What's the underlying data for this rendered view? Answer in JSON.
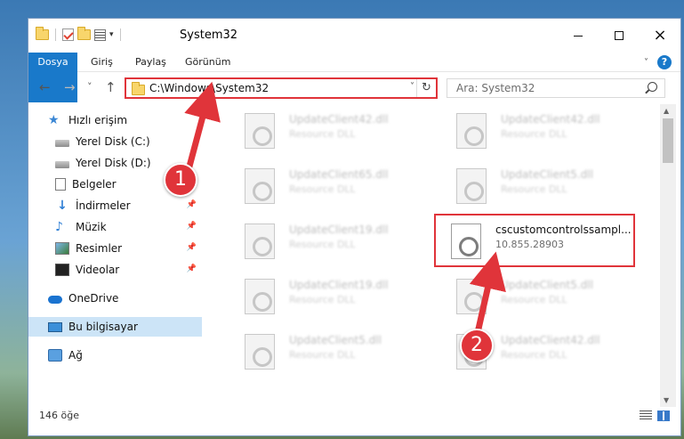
{
  "window": {
    "title": "System32",
    "controls": {
      "minimize": "minimize-icon",
      "maximize": "maximize-icon",
      "close": "×"
    }
  },
  "ribbon": {
    "tabs": [
      "Dosya",
      "Giriş",
      "Paylaş",
      "Görünüm"
    ],
    "help": "?"
  },
  "navigation": {
    "back": "←",
    "forward": "→",
    "recent": "˅",
    "up": "↑",
    "address": "C:\\Windows\\System32",
    "refresh": "↻",
    "search_placeholder": "Ara: System32"
  },
  "sidebar": {
    "items": [
      {
        "label": "Hızlı erişim",
        "icon": "star-icon"
      },
      {
        "label": "Yerel Disk (C:)",
        "icon": "drive-icon"
      },
      {
        "label": "Yerel Disk (D:)",
        "icon": "drive-icon"
      },
      {
        "label": "Belgeler",
        "icon": "document-icon"
      },
      {
        "label": "İndirmeler",
        "icon": "download-icon",
        "pinned": true
      },
      {
        "label": "Müzik",
        "icon": "music-icon",
        "pinned": true
      },
      {
        "label": "Resimler",
        "icon": "pictures-icon",
        "pinned": true
      },
      {
        "label": "Videolar",
        "icon": "video-icon",
        "pinned": true
      },
      {
        "label": "OneDrive",
        "icon": "cloud-icon"
      },
      {
        "label": "Bu bilgisayar",
        "icon": "computer-icon",
        "selected": true
      },
      {
        "label": "Ağ",
        "icon": "network-icon"
      }
    ],
    "pin_glyph": "📌"
  },
  "files": [
    {
      "name": "UpdateClient42.dll",
      "desc": "Resource DLL"
    },
    {
      "name": "UpdateClient42.dll",
      "desc": "Resource DLL"
    },
    {
      "name": "UpdateClient65.dll",
      "desc": "Resource DLL"
    },
    {
      "name": "UpdateClient5.dll",
      "desc": "Resource DLL"
    },
    {
      "name": "UpdateClient19.dll",
      "desc": "Resource DLL"
    },
    {
      "name": "cscustomcontrolssampl...",
      "desc": "10.855.28903",
      "highlight": true
    },
    {
      "name": "UpdateClient19.dll",
      "desc": "Resource DLL"
    },
    {
      "name": "UpdateClient5.dll",
      "desc": "Resource DLL"
    },
    {
      "name": "UpdateClient5.dll",
      "desc": "Resource DLL"
    },
    {
      "name": "UpdateClient42.dll",
      "desc": "Resource DLL"
    }
  ],
  "status": {
    "count": "146 öğe"
  },
  "callouts": {
    "first": "1",
    "second": "2"
  },
  "colors": {
    "accent": "#1979ca",
    "highlight_box": "#e0343a",
    "selected_nav": "#cce4f7"
  }
}
